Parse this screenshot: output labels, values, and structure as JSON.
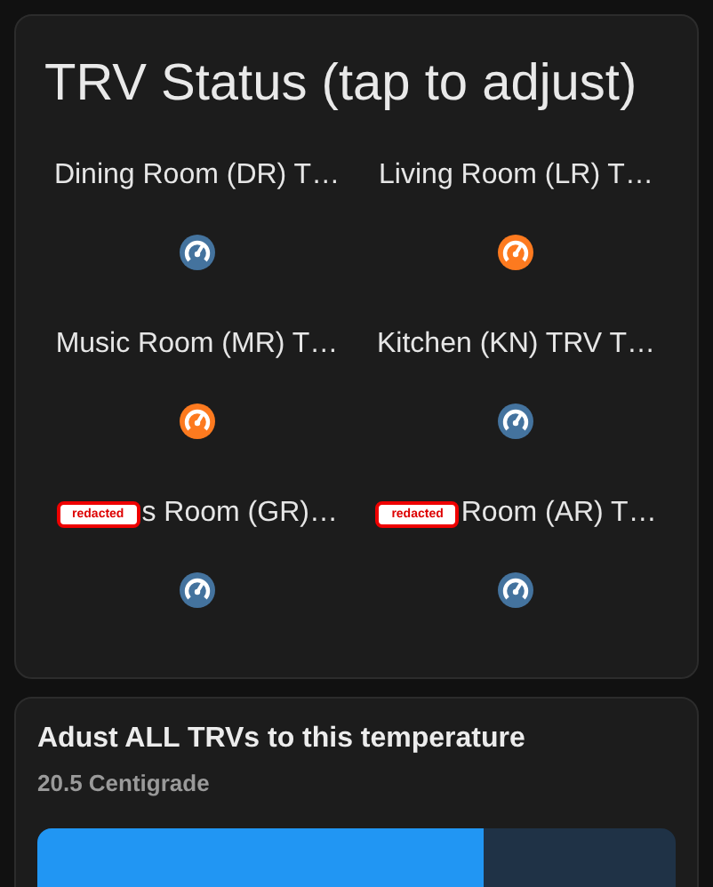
{
  "status_card": {
    "title": "TRV Status (tap to adjust)",
    "items": [
      {
        "name": "Dining Room (DR) T…",
        "color": "#44739e"
      },
      {
        "name": "Living Room (LR) T…",
        "color": "#fd7a1f"
      },
      {
        "name": "Music Room (MR) T…",
        "color": "#fd7a1f"
      },
      {
        "name": "Kitchen (KN) TRV T…",
        "color": "#44739e"
      },
      {
        "redaction": "redacted",
        "name": "s Room (GR)…",
        "color": "#44739e"
      },
      {
        "redaction": "redacted",
        "name": "Room (AR) T…",
        "color": "#44739e"
      }
    ]
  },
  "adjust_card": {
    "title": "Adust ALL TRVs to this temperature",
    "value": "20.5 Centigrade",
    "slider": {
      "level": 0.7
    }
  }
}
